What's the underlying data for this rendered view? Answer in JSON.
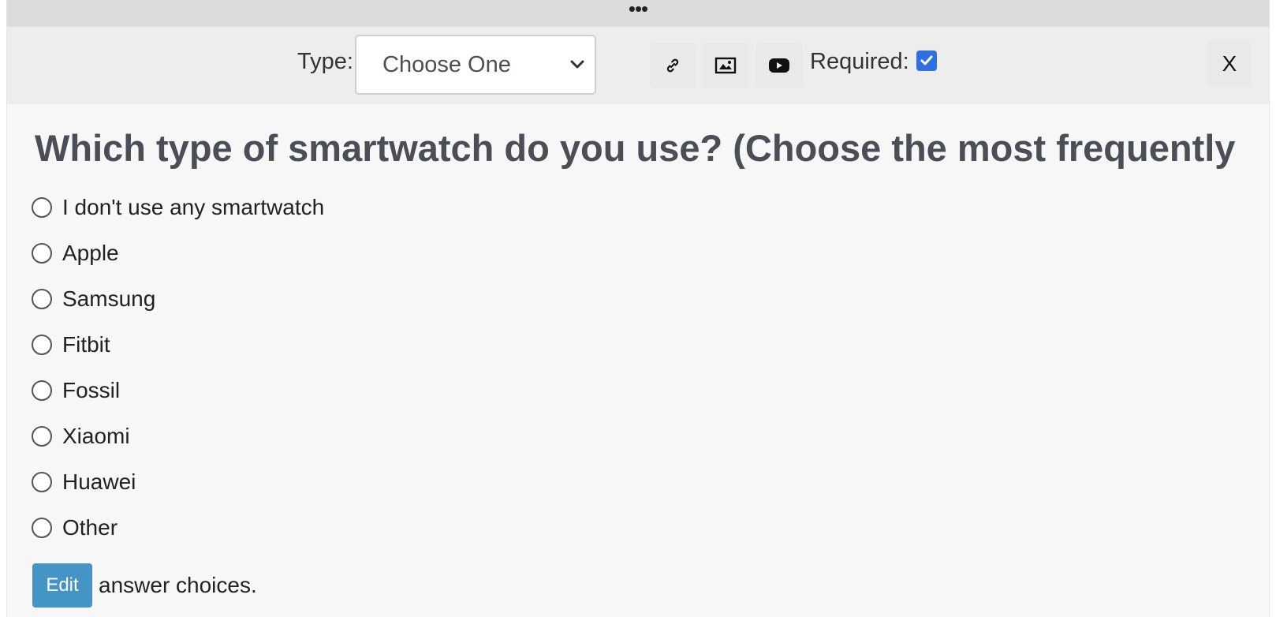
{
  "drag_handle": {
    "glyph": "•••"
  },
  "toolbar": {
    "type_label": "Type:",
    "type_select_value": "Choose One",
    "buttons": [
      {
        "icon": "link-icon"
      },
      {
        "icon": "image-icon"
      },
      {
        "icon": "youtube-icon"
      }
    ],
    "required_label": "Required:",
    "required_checked": true,
    "close_label": "X"
  },
  "question": {
    "title": "Which type of smartwatch do you use? (Choose the most frequently used)",
    "options": [
      "I don't use any smartwatch",
      "Apple",
      "Samsung",
      "Fitbit",
      "Fossil",
      "Xiaomi",
      "Huawei",
      "Other"
    ]
  },
  "edit": {
    "button_label": "Edit",
    "suffix": "answer choices."
  },
  "colors": {
    "accent_blue": "#2f6fe0",
    "edit_button": "#4494c6",
    "title_text": "#4a4f57"
  }
}
